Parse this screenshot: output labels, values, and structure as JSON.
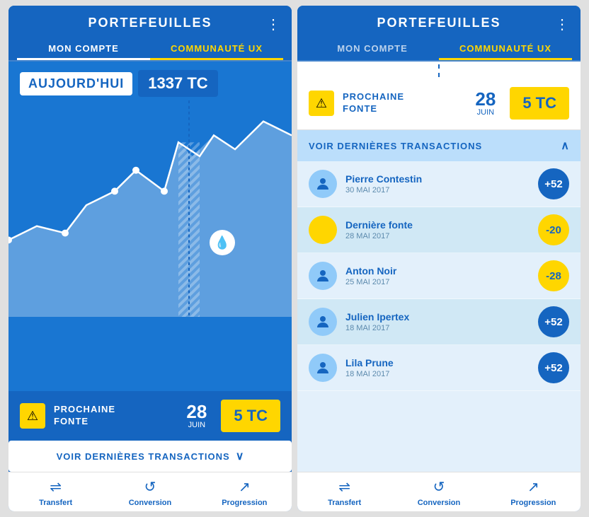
{
  "left": {
    "header": {
      "title": "PORTEFEUILLES",
      "menu": "⋮"
    },
    "tabs": [
      {
        "label": "MON COMPTE",
        "active": true
      },
      {
        "label": "COMMUNAUTÉ UX",
        "active": false
      }
    ],
    "today": {
      "label": "AUJOURD'HUI",
      "value": "1337 TC"
    },
    "fonte": {
      "warning": "⚠",
      "text_line1": "PROCHAINE",
      "text_line2": "FONTE",
      "date_num": "28",
      "date_month": "JUIN",
      "tc": "5 TC"
    },
    "voir_transactions": {
      "text": "VOIR DERNIÈRES TRANSACTIONS",
      "icon": "∨"
    },
    "nav": [
      {
        "label": "Transfert",
        "icon": "⇌"
      },
      {
        "label": "Conversion",
        "icon": "↺"
      },
      {
        "label": "Progression",
        "icon": "↗"
      }
    ]
  },
  "right": {
    "header": {
      "title": "PORTEFEUILLES",
      "menu": "⋮"
    },
    "tabs": [
      {
        "label": "MON COMPTE",
        "active": false
      },
      {
        "label": "COMMUNAUTÉ UX",
        "active": true
      }
    ],
    "fonte": {
      "warning": "⚠",
      "text_line1": "PROCHAINE",
      "text_line2": "FONTE",
      "date_num": "28",
      "date_month": "JUIN",
      "tc": "5 TC"
    },
    "voir_transactions": {
      "text": "VOIR DERNIÈRES TRANSACTIONS",
      "icon": "∧"
    },
    "transactions": [
      {
        "name": "Pierre Contestin",
        "date": "30 MAI 2017",
        "amount": "+52",
        "positive": true,
        "avatar": "person"
      },
      {
        "name": "Dernière fonte",
        "date": "28 MAI 2017",
        "amount": "-20",
        "positive": false,
        "avatar": "down"
      },
      {
        "name": "Anton Noir",
        "date": "25 MAI 2017",
        "amount": "-28",
        "positive": false,
        "avatar": "person"
      },
      {
        "name": "Julien Ipertex",
        "date": "18 MAI 2017",
        "amount": "+52",
        "positive": true,
        "avatar": "person"
      },
      {
        "name": "Lila Prune",
        "date": "18 MAI 2017",
        "amount": "+52",
        "positive": true,
        "avatar": "person"
      }
    ],
    "nav": [
      {
        "label": "Transfert",
        "icon": "⇌"
      },
      {
        "label": "Conversion",
        "icon": "↺"
      },
      {
        "label": "Progression",
        "icon": "↗"
      }
    ]
  }
}
